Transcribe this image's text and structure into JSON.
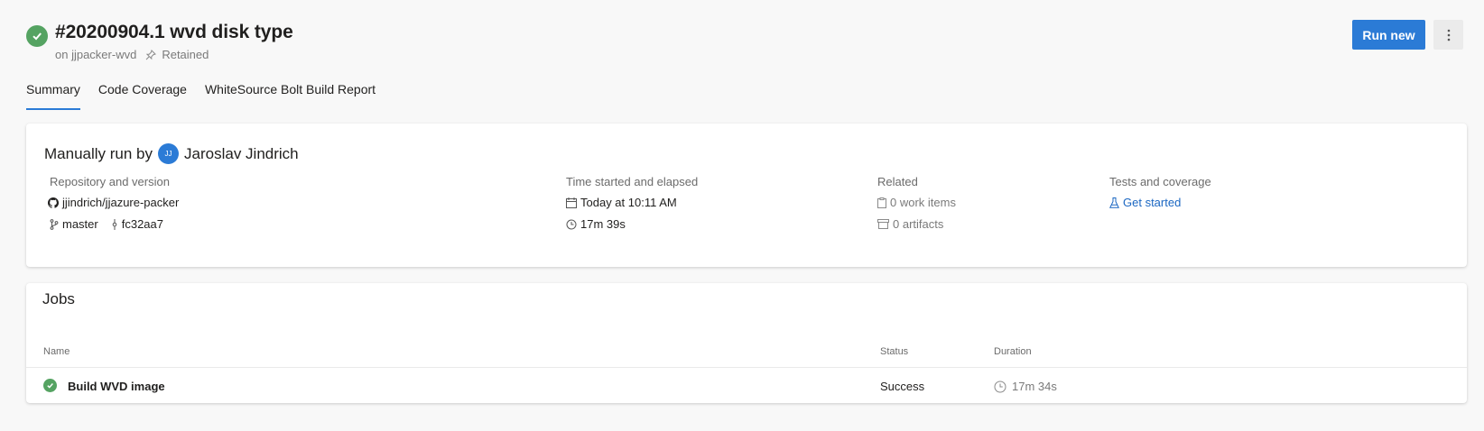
{
  "header": {
    "title": "#20200904.1 wvd disk type",
    "subtitle_on": "on jjpacker-wvd",
    "retained_label": "Retained",
    "run_new_label": "Run new",
    "status_icon": "check-circle-icon",
    "status_color": "#55a362"
  },
  "tabs": [
    {
      "label": "Summary",
      "active": true
    },
    {
      "label": "Code Coverage",
      "active": false
    },
    {
      "label": "WhiteSource Bolt Build Report",
      "active": false
    }
  ],
  "summary": {
    "run_by_prefix": "Manually run by",
    "avatar_initials": "JJ",
    "user_name": "Jaroslav Jindrich",
    "repository": {
      "label": "Repository and version",
      "repo": "jjindrich/jjazure-packer",
      "branch": "master",
      "commit": "fc32aa7"
    },
    "time": {
      "label": "Time started and elapsed",
      "started": "Today at 10:11 AM",
      "elapsed": "17m 39s"
    },
    "related": {
      "label": "Related",
      "work_items": "0 work items",
      "artifacts": "0 artifacts"
    },
    "tests": {
      "label": "Tests and coverage",
      "get_started": "Get started"
    }
  },
  "jobs": {
    "heading": "Jobs",
    "columns": {
      "name": "Name",
      "status": "Status",
      "duration": "Duration"
    },
    "rows": [
      {
        "name": "Build WVD image",
        "status": "Success",
        "duration": "17m 34s"
      }
    ]
  },
  "colors": {
    "accent": "#2b7bd6",
    "success": "#55a362",
    "link": "#1b67c2"
  }
}
